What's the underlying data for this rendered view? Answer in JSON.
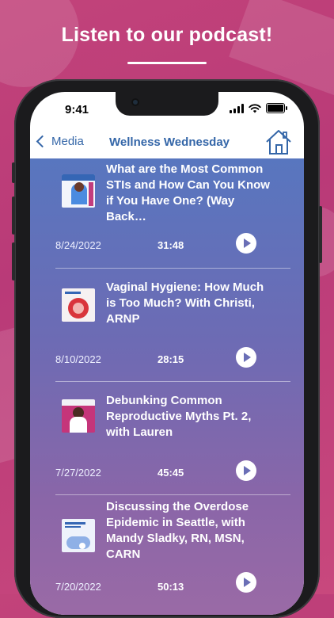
{
  "headline": "Listen to our podcast!",
  "status": {
    "time": "9:41"
  },
  "navbar": {
    "back_label": "Media",
    "title": "Wellness Wednesday",
    "home_icon": "home-icon"
  },
  "episodes": [
    {
      "title": "What are the Most Common STIs and How Can You Know if You Have One? (Way Back…",
      "date": "8/24/2022",
      "duration": "31:48"
    },
    {
      "title": "Vaginal Hygiene: How Much is Too Much? With Christi, ARNP",
      "date": "8/10/2022",
      "duration": "28:15"
    },
    {
      "title": "Debunking Common Reproductive Myths Pt. 2, with Lauren",
      "date": "7/27/2022",
      "duration": "45:45"
    },
    {
      "title": "Discussing the Overdose Epidemic in Seattle, with Mandy Sladky, RN, MSN, CARN",
      "date": "7/20/2022",
      "duration": "50:13"
    }
  ],
  "colors": {
    "background": "#c2437a",
    "accent": "#3466a8",
    "list_top": "#5876bf",
    "list_bottom": "#9a6aa6"
  }
}
